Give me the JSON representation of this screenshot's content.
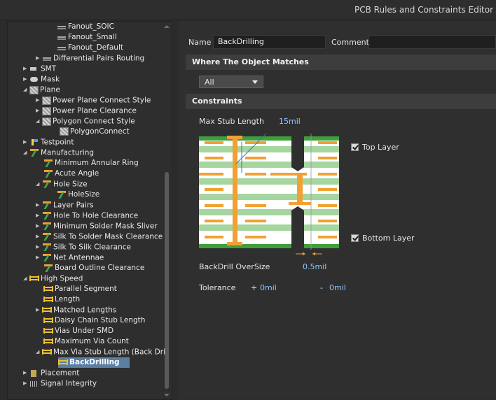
{
  "window": {
    "title": "PCB Rules and Constraints Editor [m"
  },
  "tree": [
    {
      "label": "Fanout_SOIC",
      "icon": "fanout-icon"
    },
    {
      "label": "Fanout_Small",
      "icon": "fanout-icon"
    },
    {
      "label": "Fanout_Default",
      "icon": "fanout-icon"
    },
    {
      "label": "Differential Pairs Routing",
      "icon": "fanout-icon"
    },
    {
      "label": "SMT",
      "icon": "smt-icon"
    },
    {
      "label": "Mask",
      "icon": "mask-icon"
    },
    {
      "label": "Plane",
      "icon": "plane-icon"
    },
    {
      "label": "Power Plane Connect Style",
      "icon": "plane-icon"
    },
    {
      "label": "Power Plane Clearance",
      "icon": "plane-icon"
    },
    {
      "label": "Polygon Connect Style",
      "icon": "plane-icon"
    },
    {
      "label": "PolygonConnect",
      "icon": "plane-icon"
    },
    {
      "label": "Testpoint",
      "icon": "testpoint-icon"
    },
    {
      "label": "Manufacturing",
      "icon": "manufacturing-icon"
    },
    {
      "label": "Minimum Annular Ring",
      "icon": "manufacturing-icon"
    },
    {
      "label": "Acute Angle",
      "icon": "manufacturing-icon"
    },
    {
      "label": "Hole Size",
      "icon": "manufacturing-icon"
    },
    {
      "label": "HoleSize",
      "icon": "manufacturing-icon"
    },
    {
      "label": "Layer Pairs",
      "icon": "manufacturing-icon"
    },
    {
      "label": "Hole To Hole Clearance",
      "icon": "manufacturing-icon"
    },
    {
      "label": "Minimum Solder Mask Sliver",
      "icon": "manufacturing-icon"
    },
    {
      "label": "Silk To Solder Mask Clearance",
      "icon": "manufacturing-icon"
    },
    {
      "label": "Silk To Silk Clearance",
      "icon": "manufacturing-icon"
    },
    {
      "label": "Net Antennae",
      "icon": "manufacturing-icon"
    },
    {
      "label": "Board Outline Clearance",
      "icon": "manufacturing-icon"
    },
    {
      "label": "High Speed",
      "icon": "high-speed-icon"
    },
    {
      "label": "Parallel Segment",
      "icon": "high-speed-icon"
    },
    {
      "label": "Length",
      "icon": "high-speed-icon"
    },
    {
      "label": "Matched Lengths",
      "icon": "high-speed-icon"
    },
    {
      "label": "Daisy Chain Stub Length",
      "icon": "high-speed-icon"
    },
    {
      "label": "Vias Under SMD",
      "icon": "high-speed-icon"
    },
    {
      "label": "Maximum Via Count",
      "icon": "high-speed-icon"
    },
    {
      "label": "Max Via Stub Length (Back Dril",
      "icon": "high-speed-icon"
    },
    {
      "label": "BackDrilling",
      "icon": "high-speed-icon",
      "selected": true
    },
    {
      "label": "Placement",
      "icon": "placement-icon"
    },
    {
      "label": "Signal Integrity",
      "icon": "signal-integrity-icon"
    }
  ],
  "rule": {
    "name_label": "Name",
    "name_value": "BackDrilling",
    "comment_label": "Comment",
    "comment_value": ""
  },
  "where": {
    "header": "Where The Object Matches",
    "scope": "All"
  },
  "constraints": {
    "header": "Constraints",
    "max_stub_label": "Max Stub Length",
    "max_stub_value": "15mil",
    "top_layer_label": "Top Layer",
    "top_layer_checked": true,
    "bottom_layer_label": "Bottom Layer",
    "bottom_layer_checked": true,
    "oversize_label": "BackDrill OverSize",
    "oversize_value": "0.5mil",
    "tolerance_label": "Tolerance",
    "tol_plus_sign": "+",
    "tol_plus_value": "0mil",
    "tol_minus_sign": "-",
    "tol_minus_value": "0mil"
  },
  "colors": {
    "accent_value": "#8fc7ff",
    "selection": "#5b7fa3",
    "copper": "#f2a033",
    "laminate": "#a6d6a0",
    "outer_green": "#3f9f3a"
  }
}
